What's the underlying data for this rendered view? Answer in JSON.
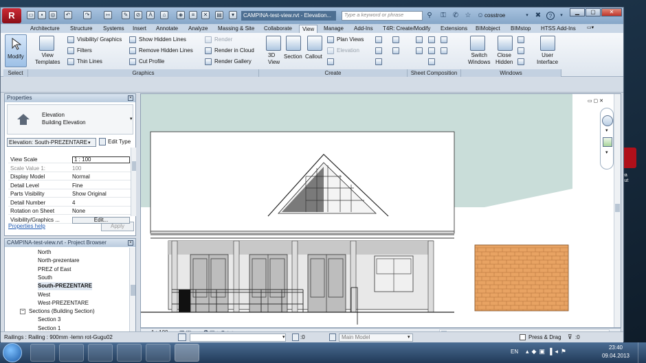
{
  "desktop": {
    "text": "ëa\ncut"
  },
  "title": {
    "app_button": "R",
    "doc_title": "CAMPINA-test-view.rvt - Elevation...",
    "search_placeholder": "Type a keyword or phrase",
    "user": "cosstroe",
    "help": "?"
  },
  "tabs": [
    "Architecture",
    "Structure",
    "Systems",
    "Insert",
    "Annotate",
    "Analyze",
    "Massing & Site",
    "Collaborate",
    "View",
    "Manage",
    "Add-Ins",
    "T4R: Create/Modify",
    "Extensions",
    "BIMobject",
    "BIMstop",
    "HTSS Add-Ins"
  ],
  "active_tab": "View",
  "ribbon": {
    "modify": "Modify",
    "view_templates": "View\nTemplates",
    "visibility_graphics": "Visibility/ Graphics",
    "filters": "Filters",
    "thin_lines": "Thin  Lines",
    "show_hidden_lines": "Show  Hidden Lines",
    "remove_hidden_lines": "Remove  Hidden Lines",
    "cut_profile": "Cut  Profile",
    "render": "Render",
    "render_in_cloud": "Render  in Cloud",
    "render_gallery": "Render  Gallery",
    "view_3d": "3D\nView",
    "section": "Section",
    "callout": "Callout",
    "plan_views": "Plan  Views",
    "elevation": "Elevation",
    "switch_windows": "Switch\nWindows",
    "close_hidden": "Close\nHidden",
    "user_interface": "User\nInterface",
    "groups": {
      "select": "Select",
      "graphics": "Graphics",
      "create": "Create",
      "sheet_composition": "Sheet Composition",
      "windows": "Windows"
    }
  },
  "properties": {
    "header": "Properties",
    "type_name": "Elevation",
    "type_sub": "Building Elevation",
    "selector": "Elevation: South-PREZENTARE",
    "edit_type": "Edit Type",
    "rows": [
      {
        "k": "View Scale",
        "v": "1 : 100"
      },
      {
        "k": "Scale Value    1:",
        "v": "100"
      },
      {
        "k": "Display Model",
        "v": "Normal"
      },
      {
        "k": "Detail Level",
        "v": "Fine"
      },
      {
        "k": "Parts Visibility",
        "v": "Show Original"
      },
      {
        "k": "Detail Number",
        "v": "4"
      },
      {
        "k": "Rotation on Sheet",
        "v": "None"
      },
      {
        "k": "Visibility/Graphics ...",
        "v": "Edit..."
      }
    ],
    "help": "Properties help",
    "apply": "Apply"
  },
  "browser": {
    "header": "CAMPINA-test-view.rvt - Project Browser",
    "items": [
      "North",
      "North-prezentare",
      "PREZ of East",
      "South",
      "South-PREZENTARE",
      "West",
      "West-PREZENTARE",
      "Sections (Building Section)",
      "Section 3",
      "Section 1"
    ],
    "selected": "South-PREZENTARE",
    "expander": "−"
  },
  "viewbar": {
    "scale": "1 : 100"
  },
  "status": {
    "text": "Railings : Railing : 900mm -lemn rot-Gugu02",
    "zero1": ":0",
    "main_model": "Main Model",
    "press_drag": "Press & Drag",
    "zero2": ":0"
  },
  "tray": {
    "lang": "EN",
    "time": "23:40",
    "date": "09.04.2013"
  },
  "colors": {
    "ribbon_bg": "#dde5ee",
    "titlebar": "#86a6c8",
    "brick": "#e8a363",
    "canvas_bg": "#c9ddd9"
  }
}
